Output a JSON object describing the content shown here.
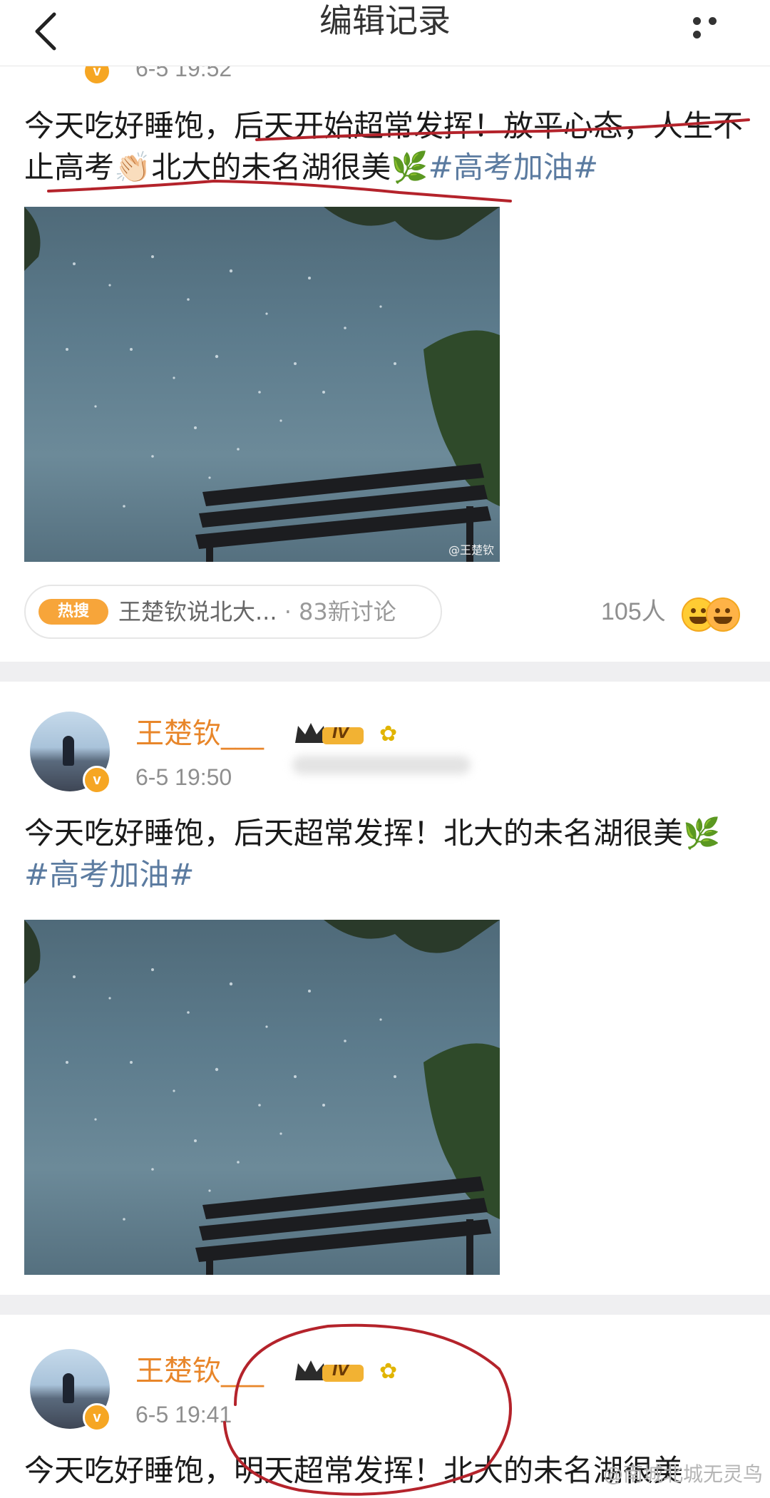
{
  "header": {
    "title": "编辑记录",
    "back_icon": "chevron-left-icon",
    "more_icon": "more-dots-icon"
  },
  "posts": [
    {
      "time": "6-5 19:52",
      "text_main": "今天吃好睡饱，后天开始超常发挥！放平心态，人生不止高考",
      "text_emoji": "👏🏻",
      "text_after": "北大的未名湖很美",
      "leaf": "🌿",
      "tag": "#高考加油#",
      "image_watermark": "@王楚钦",
      "hot_search": {
        "badge": "热搜",
        "topic": "王楚钦说北大...",
        "discussion": "· 83新讨论"
      },
      "reactions": "105人"
    },
    {
      "username": "王楚钦___",
      "level": "IV",
      "time": "6-5 19:50",
      "text_main": "今天吃好睡饱，后天超常发挥！北大的未名湖很美",
      "leaf": "🌿",
      "tag": "#高考加油#"
    },
    {
      "username": "王楚钦___",
      "level": "IV",
      "time": "6-5 19:41",
      "text_main": "今天吃好睡饱，明天超常发挥！北大的未名湖很美"
    }
  ],
  "footer_watermark": "@南城北城无灵鸟",
  "colors": {
    "username": "#e8862a",
    "hashtag": "#5b7ba0",
    "hot_badge": "#f7a53a",
    "annotation": "#b4232b"
  }
}
